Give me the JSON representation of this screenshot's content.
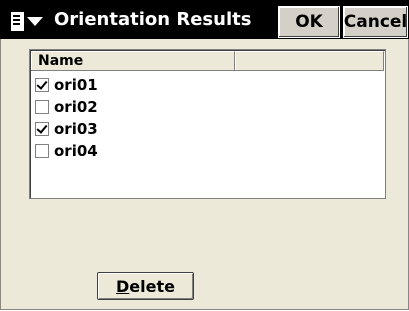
{
  "titlebar": {
    "title": "Orientation Results",
    "ok_label": "OK",
    "cancel_label": "Cancel"
  },
  "list": {
    "columns": [
      "Name",
      ""
    ],
    "rows": [
      {
        "name": "ori01",
        "checked": true
      },
      {
        "name": "ori02",
        "checked": false
      },
      {
        "name": "ori03",
        "checked": true
      },
      {
        "name": "ori04",
        "checked": false
      }
    ]
  },
  "actions": {
    "delete_first": "D",
    "delete_rest": "elete"
  },
  "icons": {
    "menu": "document-menu-icon",
    "dropdown": "chevron-down-icon"
  }
}
